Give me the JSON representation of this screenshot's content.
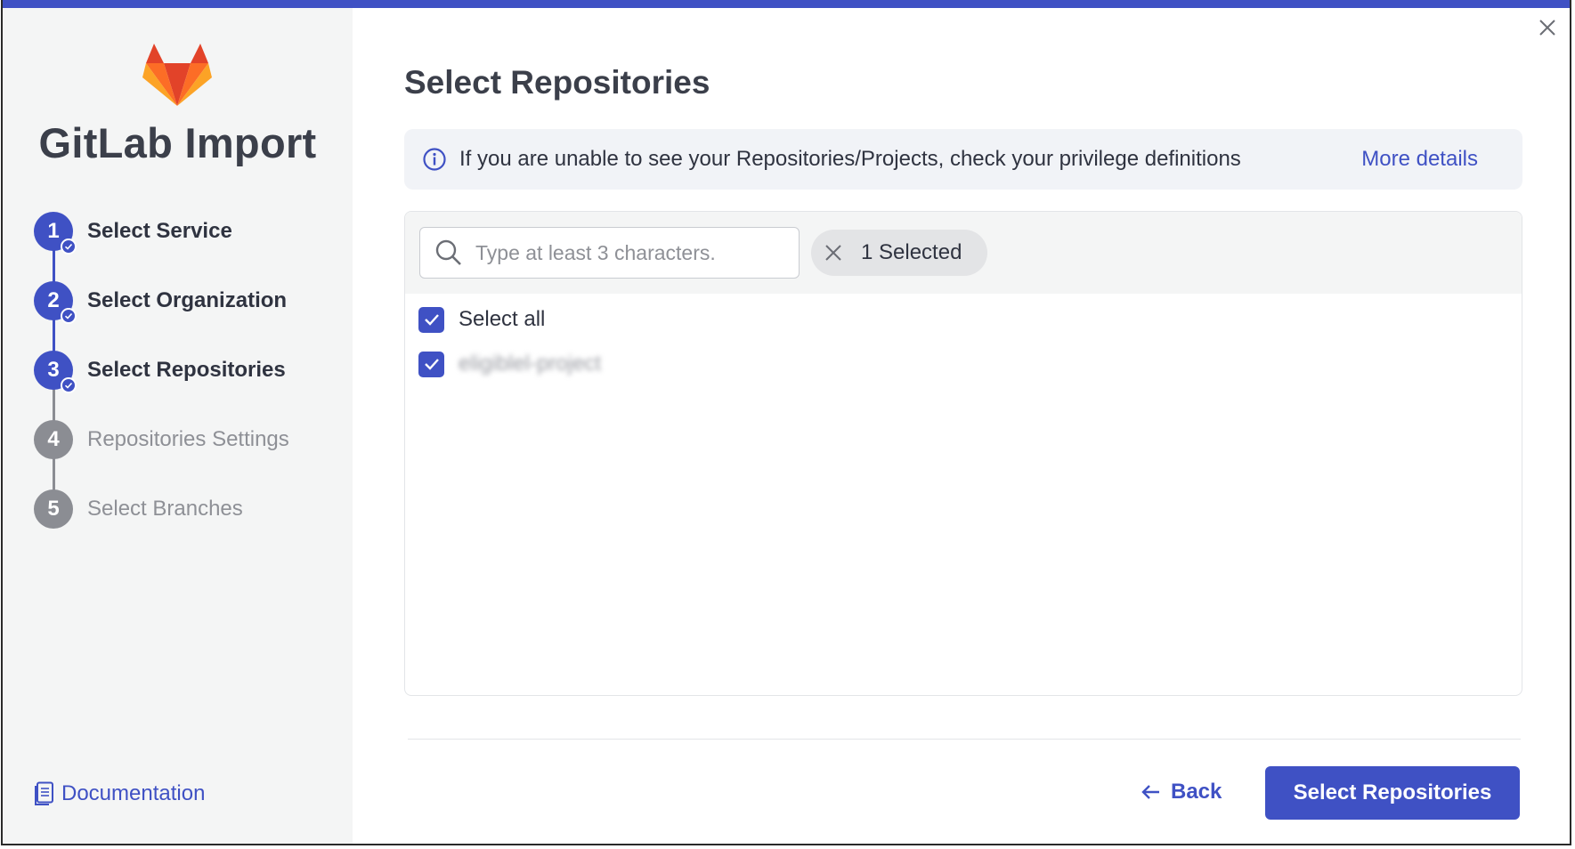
{
  "sidebar": {
    "app_title": "GitLab Import",
    "steps": [
      {
        "number": "1",
        "label": "Select Service",
        "state": "done"
      },
      {
        "number": "2",
        "label": "Select Organization",
        "state": "done"
      },
      {
        "number": "3",
        "label": "Select Repositories",
        "state": "done"
      },
      {
        "number": "4",
        "label": "Repositories Settings",
        "state": "todo"
      },
      {
        "number": "5",
        "label": "Select Branches",
        "state": "todo"
      }
    ],
    "documentation_label": "Documentation"
  },
  "main": {
    "title": "Select Repositories",
    "info_banner": {
      "text": "If you are unable to see your Repositories/Projects, check your privilege definitions",
      "link_label": "More details"
    },
    "search": {
      "placeholder": "Type at least 3 characters.",
      "value": ""
    },
    "selected_chip_label": "1 Selected",
    "select_all_label": "Select all",
    "repositories": [
      {
        "name": "eligiblel-project",
        "checked": true
      }
    ],
    "footer": {
      "back_label": "Back",
      "primary_label": "Select Repositories"
    }
  },
  "colors": {
    "accent": "#3f51c4",
    "sidebar_bg": "#f4f5f5",
    "inactive_step": "#8b8d93"
  },
  "icons": [
    "gitlab-logo",
    "check-icon",
    "document-icon",
    "close-icon",
    "info-icon",
    "search-icon",
    "arrow-left-icon"
  ]
}
